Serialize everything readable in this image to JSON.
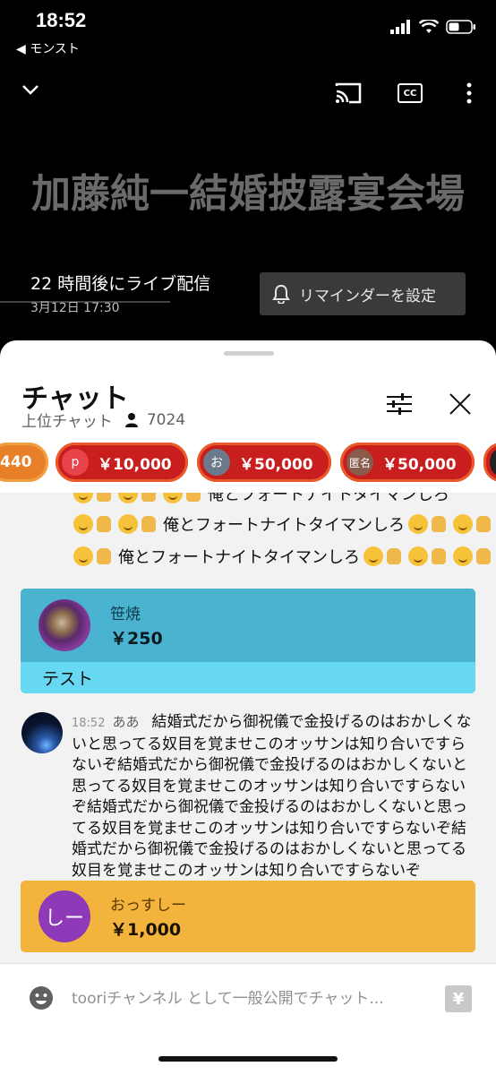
{
  "status": {
    "time": "18:52",
    "back_app": "◀ モンスト"
  },
  "player": {
    "title": "加藤純一結婚披露宴会場",
    "live_text": "22 時間後にライブ配信",
    "live_date": "3月12日 17:30",
    "reminder_label": "リマインダーを設定"
  },
  "chat": {
    "title": "チャット",
    "mode": "上位チャット",
    "viewer_count": "7024",
    "chips": [
      {
        "avatar": "",
        "amount": "440",
        "color": "#e8802a"
      },
      {
        "avatar": "p",
        "amount": "￥10,000",
        "color": "#c81e1e",
        "avatar_color": "#e8434a"
      },
      {
        "avatar": "お",
        "amount": "￥50,000",
        "color": "#c81e1e",
        "avatar_color": "#6a7a8a"
      },
      {
        "avatar": "匿名",
        "amount": "￥50,000",
        "color": "#c81e1e",
        "avatar_color": "#8a5a4a"
      }
    ],
    "emoji_message": "俺とフォートナイトタイマンしろ",
    "superchats": [
      {
        "name": "笹焼",
        "amount": "￥250",
        "message": "テスト",
        "head_color": "#4ab3d0",
        "body_color": "#66d8f2"
      },
      {
        "name": "おっすしー",
        "amount": "￥1,000",
        "avatar_letter": "しー",
        "head_color": "#f2b43c"
      }
    ],
    "message": {
      "time": "18:52",
      "author": "ああ",
      "text": "結婚式だから御祝儀で金投げるのはおかしくないと思ってる奴目を覚ませこのオッサンは知り合いですらないぞ結婚式だから御祝儀で金投げるのはおかしくないと思ってる奴目を覚ませこのオッサンは知り合いですらないぞ結婚式だから御祝儀で金投げるのはおかしくないと思ってる奴目を覚ませこのオッサンは知り合いですらないぞ結婚式だから御祝儀で金投げるのはおかしくないと思ってる奴目を覚ませこのオッサンは知り合いですらないぞ"
    },
    "input_placeholder": "tooriチャンネル として一般公開でチャット..."
  }
}
